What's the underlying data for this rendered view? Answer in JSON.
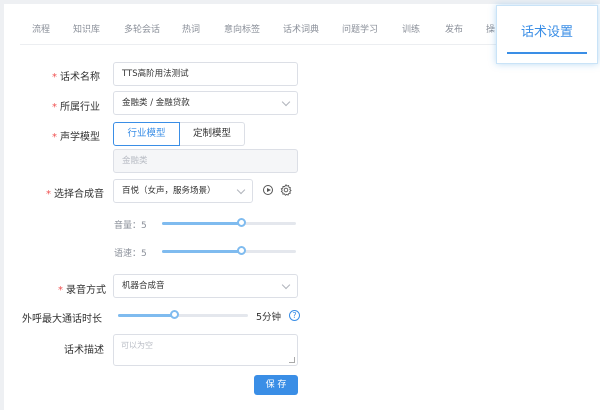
{
  "tabs": [
    "流程",
    "知识库",
    "多轮会话",
    "热词",
    "意向标签",
    "话术词典",
    "问题学习",
    "训练",
    "发布",
    "操"
  ],
  "active_tab": "话术设置",
  "form": {
    "name_label": "话术名称",
    "name_value": "TTS高阶用法测试",
    "industry_label": "所属行业",
    "industry_value": "金融类 / 金融贷款",
    "acoustic_label": "声学模型",
    "acoustic_options": [
      "行业模型",
      "定制模型"
    ],
    "acoustic_selected": "行业模型",
    "acoustic_value": "金融类",
    "voice_label": "选择合成音",
    "voice_value": "百悦（女声，服务场景）",
    "volume_label": "音量：",
    "volume_value": "5",
    "volume_level": 0.6,
    "speed_label": "语速：",
    "speed_value": "5",
    "speed_level": 0.6,
    "record_label": "录音方式",
    "record_value": "机器合成音",
    "duration_label": "外呼最大通话时长",
    "duration_value": "5分钟",
    "duration_level": 0.44,
    "desc_label": "话术描述",
    "desc_placeholder": "可以为空",
    "save_label": "保 存",
    "help_glyph": "?"
  },
  "colors": {
    "accent": "#3a8ee6",
    "slider": "#7fbbef",
    "required": "#f05050"
  },
  "icons": {
    "play": "play-circle-icon",
    "settings": "gear-icon",
    "help": "question-circle-icon",
    "dropdown": "chevron-down-icon"
  }
}
